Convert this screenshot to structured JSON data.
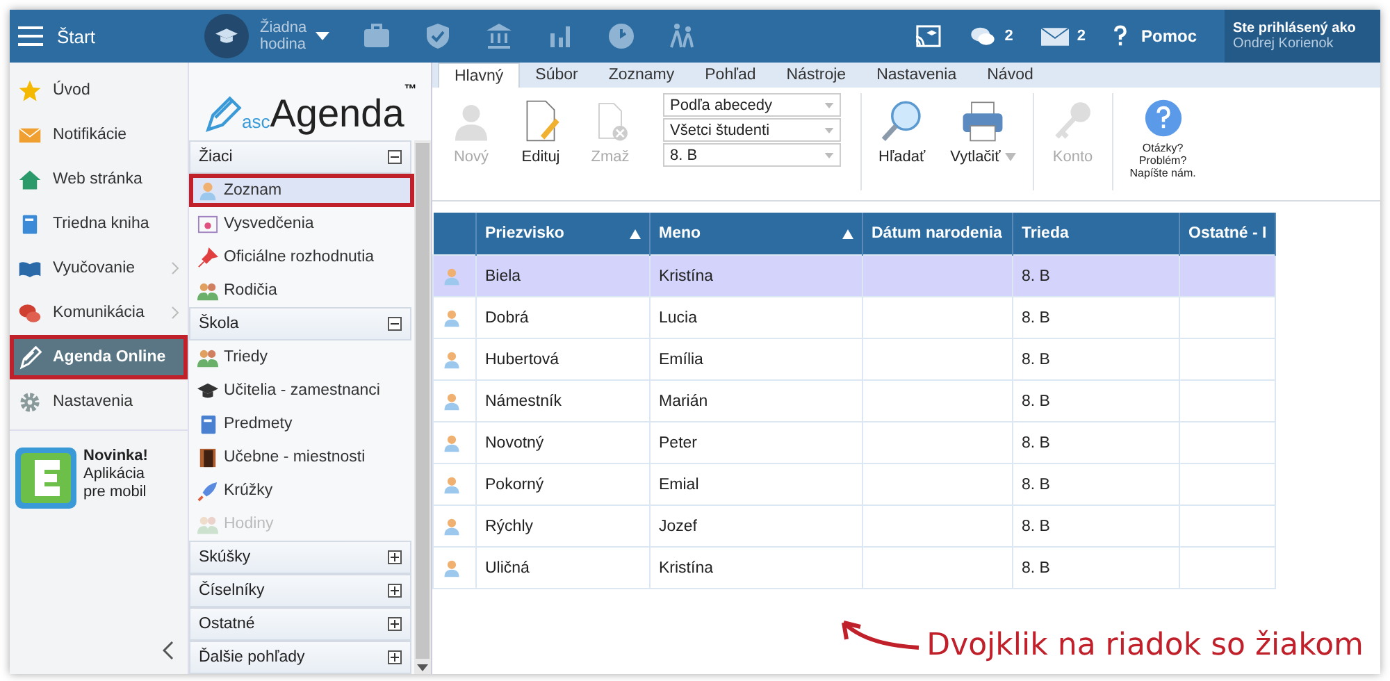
{
  "topbar": {
    "menu_label": "Štart",
    "lesson": [
      "Žiadna",
      "hodina"
    ],
    "chat_count": "2",
    "mail_count": "2",
    "help": "Pomoc",
    "login_title": "Ste prihlásený ako",
    "login_name": "Ondrej Korienok"
  },
  "sidebar": {
    "items": [
      {
        "label": "Úvod",
        "kind": "star",
        "arrow": false,
        "selected": false,
        "highlighted": false
      },
      {
        "label": "Notifikácie",
        "kind": "mail",
        "arrow": false,
        "selected": false,
        "highlighted": false
      },
      {
        "label": "Web stránka",
        "kind": "house",
        "arrow": false,
        "selected": false,
        "highlighted": false
      },
      {
        "label": "Triedna kniha",
        "kind": "book",
        "arrow": false,
        "selected": false,
        "highlighted": false
      },
      {
        "label": "Vyučovanie",
        "kind": "openbook",
        "arrow": true,
        "selected": false,
        "highlighted": false
      },
      {
        "label": "Komunikácia",
        "kind": "chat",
        "arrow": true,
        "selected": false,
        "highlighted": false
      },
      {
        "label": "Agenda Online",
        "kind": "pen",
        "arrow": false,
        "selected": true,
        "highlighted": true
      },
      {
        "label": "Nastavenia",
        "kind": "gear",
        "arrow": false,
        "selected": false,
        "highlighted": false
      }
    ],
    "promo": {
      "title": "Novinka!",
      "lines": [
        "Aplikácia",
        "pre mobil"
      ]
    }
  },
  "nav": {
    "logo": {
      "prefix": "asc",
      "name": "Agenda",
      "mark": "™"
    },
    "sections": [
      {
        "title": "Žiaci",
        "expanded": true,
        "items": [
          {
            "label": "Zoznam",
            "kind": "person",
            "selected": true,
            "highlighted": true,
            "disabled": false
          },
          {
            "label": "Vysvedčenia",
            "kind": "certificate",
            "selected": false,
            "highlighted": false,
            "disabled": false
          },
          {
            "label": "Oficiálne rozhodnutia",
            "kind": "pin",
            "selected": false,
            "highlighted": false,
            "disabled": false
          },
          {
            "label": "Rodičia",
            "kind": "people",
            "selected": false,
            "highlighted": false,
            "disabled": false
          }
        ]
      },
      {
        "title": "Škola",
        "expanded": true,
        "items": [
          {
            "label": "Triedy",
            "kind": "people",
            "selected": false,
            "highlighted": false,
            "disabled": false
          },
          {
            "label": "Učitelia - zamestnanci",
            "kind": "cap",
            "selected": false,
            "highlighted": false,
            "disabled": false
          },
          {
            "label": "Predmety",
            "kind": "book",
            "selected": false,
            "highlighted": false,
            "disabled": false
          },
          {
            "label": "Učebne - miestnosti",
            "kind": "door",
            "selected": false,
            "highlighted": false,
            "disabled": false
          },
          {
            "label": "Krúžky",
            "kind": "rocket",
            "selected": false,
            "highlighted": false,
            "disabled": false
          },
          {
            "label": "Hodiny",
            "kind": "people",
            "selected": false,
            "highlighted": false,
            "disabled": true
          }
        ]
      },
      {
        "title": "Skúšky",
        "expanded": false
      },
      {
        "title": "Číselníky",
        "expanded": false
      },
      {
        "title": "Ostatné",
        "expanded": false
      },
      {
        "title": "Ďalšie pohľady",
        "expanded": false
      }
    ]
  },
  "ribbon": {
    "tabs": [
      {
        "label": "Hlavný",
        "selected": true
      },
      {
        "label": "Súbor",
        "selected": false
      },
      {
        "label": "Zoznamy",
        "selected": false
      },
      {
        "label": "Pohľad",
        "selected": false
      },
      {
        "label": "Nástroje",
        "selected": false
      },
      {
        "label": "Nastavenia",
        "selected": false
      },
      {
        "label": "Návod",
        "selected": false
      }
    ],
    "buttons_left": [
      {
        "label": "Nový",
        "kind": "person",
        "disabled": true
      },
      {
        "label": "Edituj",
        "kind": "edit",
        "disabled": false
      },
      {
        "label": "Zmaž",
        "kind": "delete",
        "disabled": true
      }
    ],
    "selects": [
      "Podľa abecedy",
      "Všetci študenti",
      "8. B"
    ],
    "buttons_right": [
      {
        "label": "Hľadať",
        "kind": "search",
        "disabled": false,
        "dropdown": false
      },
      {
        "label": "Vytlačiť",
        "kind": "print",
        "disabled": false,
        "dropdown": true
      },
      {
        "label": "Konto",
        "kind": "key",
        "disabled": true,
        "dropdown": false
      }
    ],
    "help_lines": [
      "Otázky?",
      "Problém?",
      "Napíšte nám."
    ]
  },
  "table": {
    "columns": [
      {
        "label": "Priezvisko",
        "sorted": true
      },
      {
        "label": "Meno",
        "sorted": true
      },
      {
        "label": "Dátum narodenia",
        "sorted": false
      },
      {
        "label": "Trieda",
        "sorted": false
      },
      {
        "label": "Ostatné - I",
        "sorted": false
      }
    ],
    "rows": [
      {
        "surname": "Biela",
        "name": "Kristína",
        "class": "8. B",
        "selected": true
      },
      {
        "surname": "Dobrá",
        "name": "Lucia",
        "class": "8. B",
        "selected": false
      },
      {
        "surname": "Hubertová",
        "name": "Emília",
        "class": "8. B",
        "selected": false
      },
      {
        "surname": "Námestník",
        "name": "Marián",
        "class": "8. B",
        "selected": false
      },
      {
        "surname": "Novotný",
        "name": "Peter",
        "class": "8. B",
        "selected": false
      },
      {
        "surname": "Pokorný",
        "name": "Emial",
        "class": "8. B",
        "selected": false
      },
      {
        "surname": "Rýchly",
        "name": "Jozef",
        "class": "8. B",
        "selected": false
      },
      {
        "surname": "Uličná",
        "name": "Kristína",
        "class": "8. B",
        "selected": false
      }
    ]
  },
  "annotation": "Dvojklik na riadok so žiakom"
}
